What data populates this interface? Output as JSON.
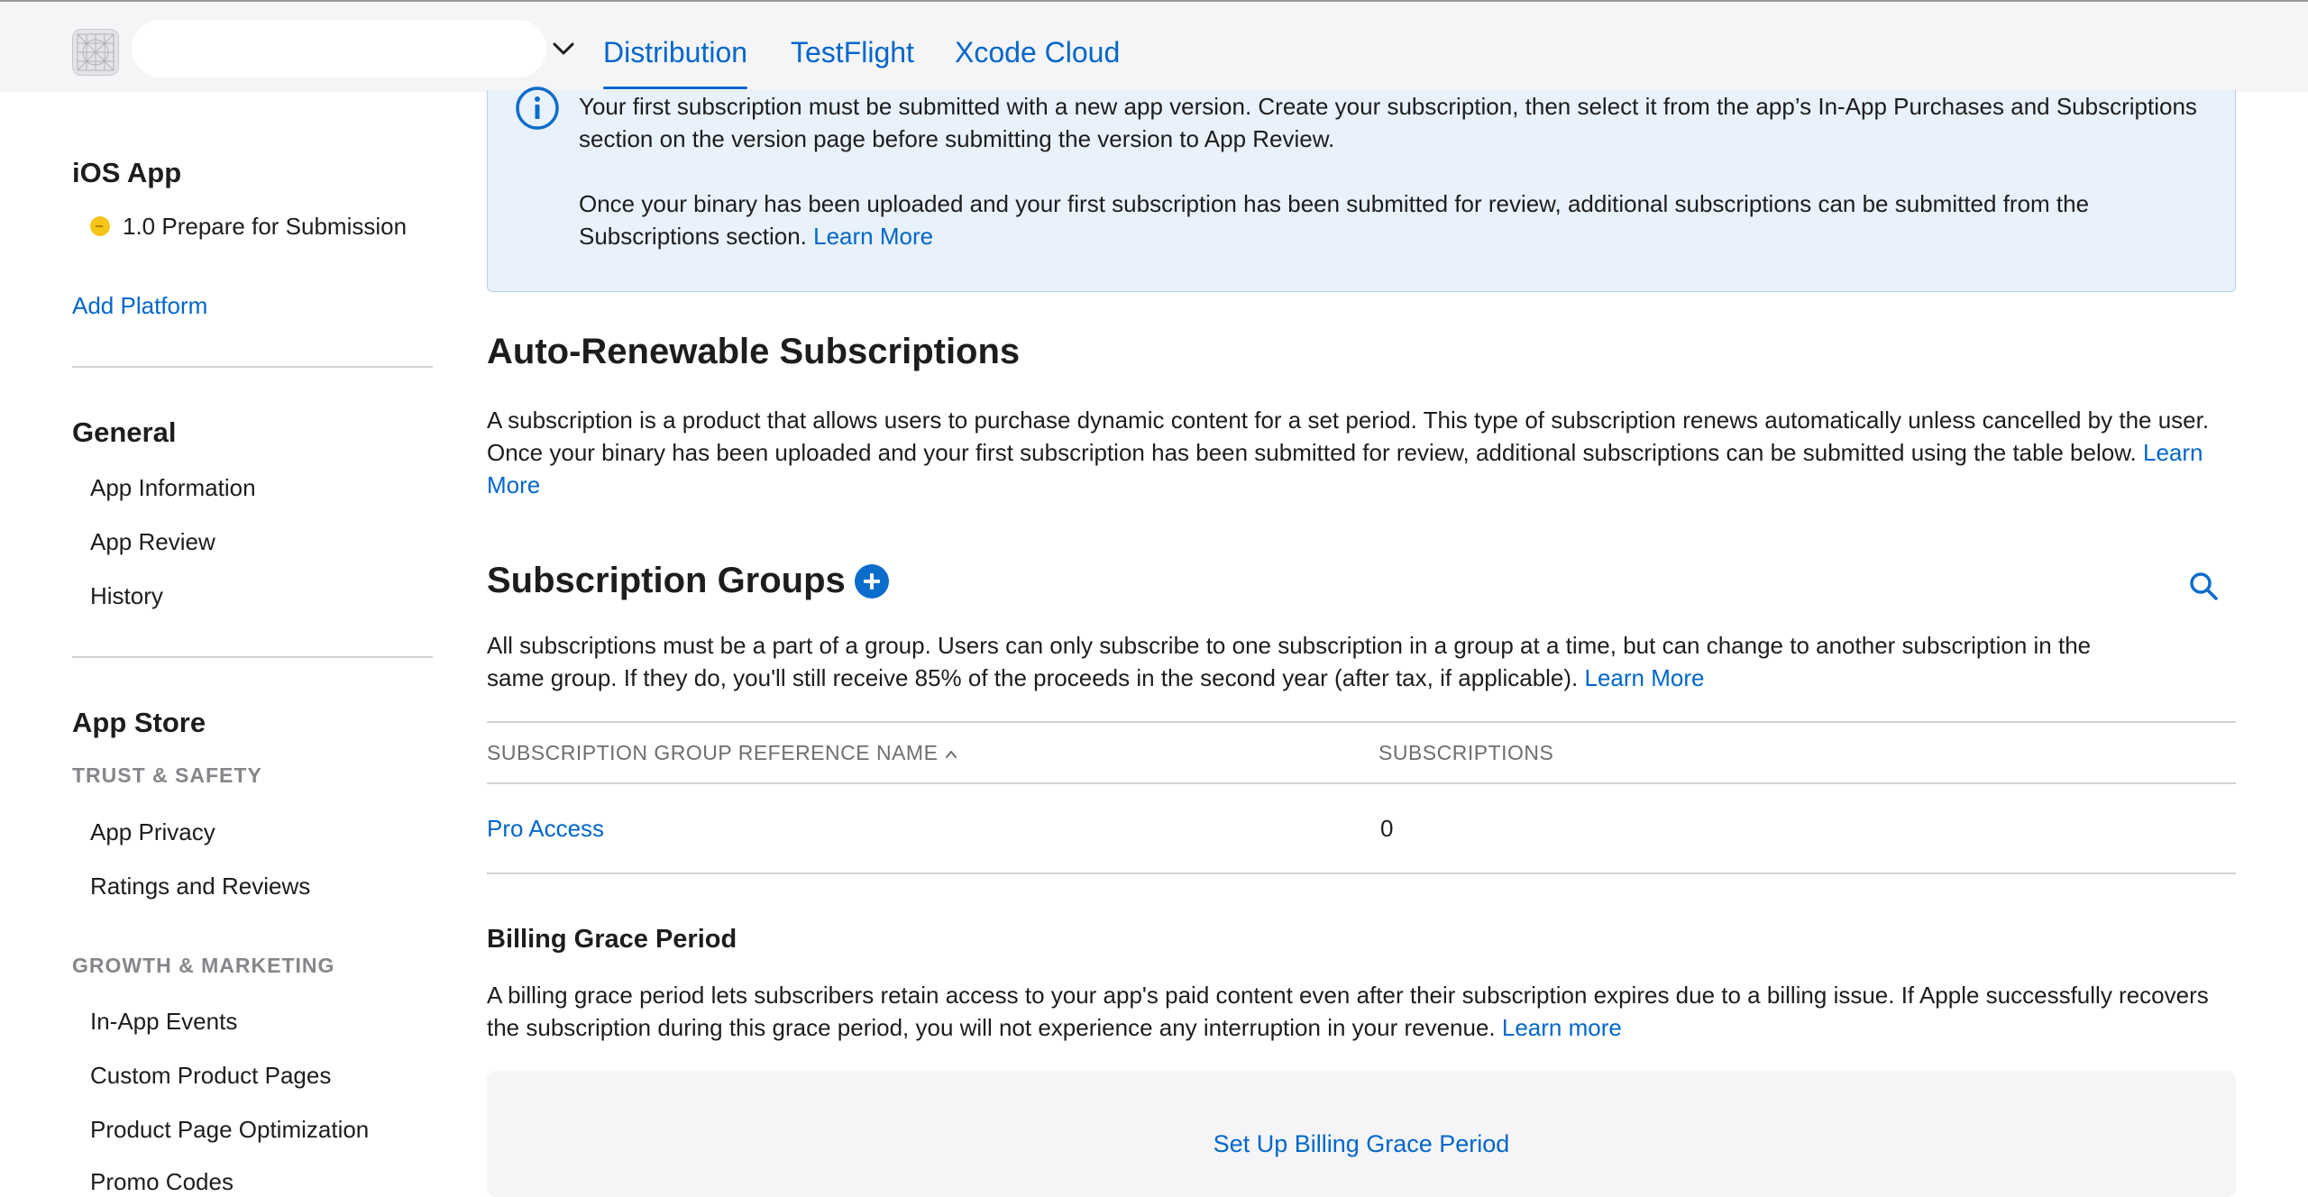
{
  "topbar": {
    "tabs": [
      {
        "label": "Distribution",
        "active": true
      },
      {
        "label": "TestFlight",
        "active": false
      },
      {
        "label": "Xcode Cloud",
        "active": false
      }
    ]
  },
  "sidebar": {
    "platform_heading": "iOS App",
    "version_status": "1.0 Prepare for Submission",
    "add_platform": "Add Platform",
    "general_heading": "General",
    "general_items": [
      "App Information",
      "App Review",
      "History"
    ],
    "app_store_heading": "App Store",
    "trust_safety_label": "TRUST & SAFETY",
    "trust_items": [
      "App Privacy",
      "Ratings and Reviews"
    ],
    "growth_label": "GROWTH & MARKETING",
    "growth_items": [
      "In-App Events",
      "Custom Product Pages",
      "Product Page Optimization",
      "Promo Codes"
    ]
  },
  "info_banner": {
    "para1": "Your first subscription must be submitted with a new app version. Create your subscription, then select it from the app’s In-App Purchases and Subscriptions section on the version page before submitting the version to App Review.",
    "para2": "Once your binary has been uploaded and your first subscription has been submitted for review, additional subscriptions can be submitted from the Subscriptions section.",
    "learn_more": "Learn More"
  },
  "auto_renewable": {
    "title": "Auto-Renewable Subscriptions",
    "description": "A subscription is a product that allows users to purchase dynamic content for a set period. This type of subscription renews automatically unless cancelled by the user. Once your binary has been uploaded and your first subscription has been submitted for review, additional subscriptions can be submitted using the table below.",
    "learn_more": "Learn More"
  },
  "subscription_groups": {
    "title": "Subscription Groups",
    "description": "All subscriptions must be a part of a group. Users can only subscribe to one subscription in a group at a time, but can change to another subscription in the same group. If they do, you'll still receive 85% of the proceeds in the second year (after tax, if applicable).",
    "learn_more": "Learn More",
    "columns": [
      "SUBSCRIPTION GROUP REFERENCE NAME",
      "SUBSCRIPTIONS"
    ],
    "rows": [
      {
        "name": "Pro Access",
        "subscriptions": "0"
      }
    ]
  },
  "billing_grace": {
    "title": "Billing Grace Period",
    "description": "A billing grace period lets subscribers retain access to your app's paid content even after their subscription expires due to a billing issue. If Apple successfully recovers the subscription during this grace period, you will not experience any interruption in your revenue.",
    "learn_more": "Learn more",
    "setup_button": "Set Up Billing Grace Period"
  },
  "colors": {
    "accent": "#0066cc",
    "info_bg": "#e9f1fa",
    "status_yellow": "#f5c518"
  }
}
